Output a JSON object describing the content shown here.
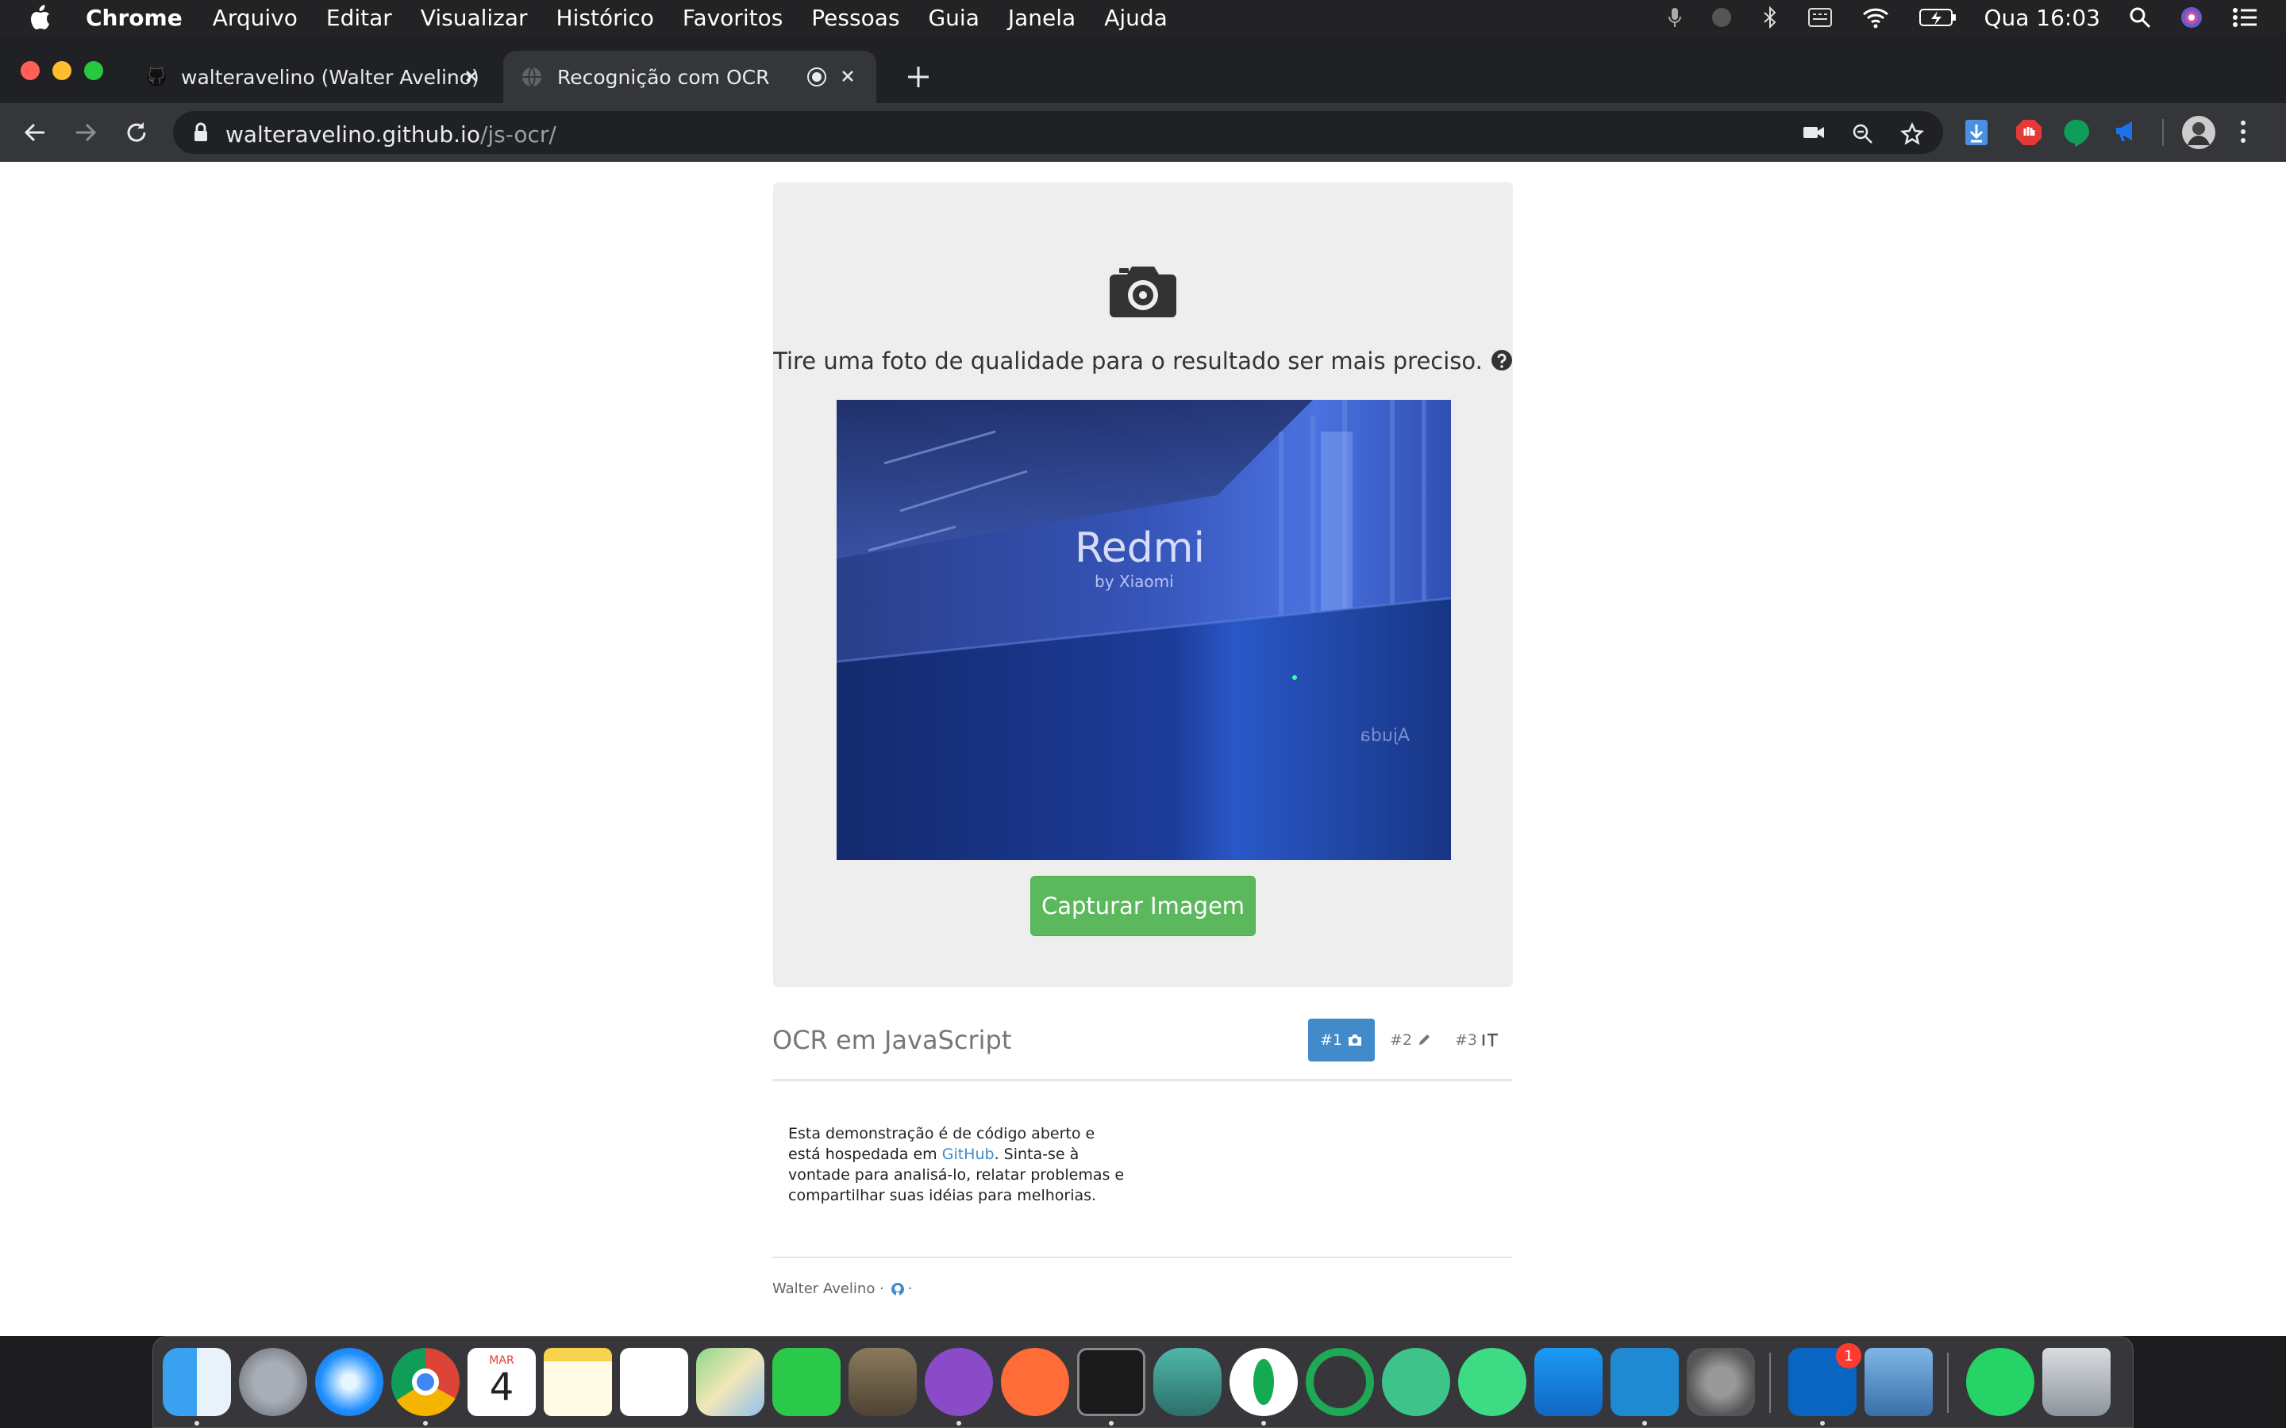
{
  "menubar": {
    "app_name": "Chrome",
    "items": [
      "Arquivo",
      "Editar",
      "Visualizar",
      "Histórico",
      "Favoritos",
      "Pessoas",
      "Guia",
      "Janela",
      "Ajuda"
    ],
    "clock": "Qua 16:03",
    "status_icons": [
      "microphone-icon",
      "moon-icon",
      "bluetooth-icon",
      "keyboard-icon",
      "wifi-icon",
      "battery-icon",
      "spotlight-icon",
      "siri-icon",
      "notification-center-icon"
    ]
  },
  "tabs": [
    {
      "title": "walteravelino (Walter Avelino)",
      "active": false
    },
    {
      "title": "Recognição com OCR",
      "active": true
    }
  ],
  "toolbar": {
    "url_host": "walteravelino.github.io",
    "url_path": "/js-ocr/"
  },
  "page": {
    "instruction": "Tire uma foto de qualidade para o resultado ser mais preciso.",
    "preview_text": {
      "brand": "Redmi",
      "sub": "by Xiaomi",
      "mirrored": "Ajuda"
    },
    "capture_button": "Capturar Imagem",
    "title": "OCR em JavaScript",
    "steps": [
      "#1",
      "#2",
      "#3"
    ],
    "description": {
      "part1": "Esta demonstração é de código aberto e está hospedada em ",
      "link": "GitHub",
      "part2": ". Sinta-se à vontade para analisá-lo, relatar problemas e compartilhar suas idéias para melhorias."
    },
    "footer": {
      "author": "Walter Avelino ·",
      "trail": "·"
    }
  },
  "dock": {
    "apps": [
      "Finder",
      "Launchpad",
      "Safari",
      "Chrome",
      "Calendar",
      "Notes",
      "Reminders",
      "Maps",
      "FaceTime",
      "GIMP",
      "GitHub Desktop",
      "Postman",
      "Terminal",
      "Activity Monitor",
      "MongoDB Compass",
      "Sourcetree",
      "Atom",
      "Android Studio",
      "Xcode",
      "VS Code",
      "System Preferences",
      "Outlook",
      "Preview",
      "WhatsApp",
      "Trash"
    ],
    "calendar_month": "MAR",
    "calendar_day": "4",
    "outlook_badge": "1"
  }
}
